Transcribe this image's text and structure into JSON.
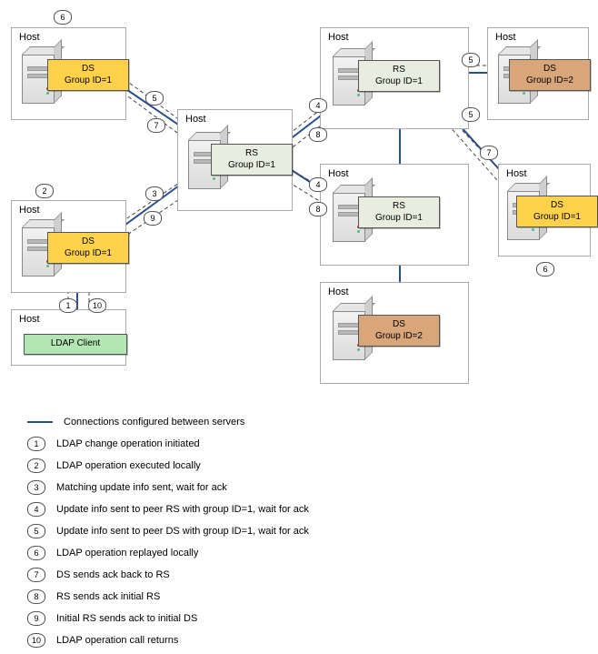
{
  "hosts": {
    "h1": {
      "label": "Host"
    },
    "h2": {
      "label": "Host"
    },
    "h3": {
      "label": "Host"
    },
    "h4": {
      "label": "Host"
    },
    "h5": {
      "label": "Host"
    },
    "h6": {
      "label": "Host"
    },
    "h7": {
      "label": "Host"
    },
    "h8": {
      "label": "Host"
    }
  },
  "nodes": {
    "ds_topleft": {
      "line1": "DS",
      "line2": "Group ID=1"
    },
    "ds_midleft": {
      "line1": "DS",
      "line2": "Group ID=1"
    },
    "rs_center": {
      "line1": "RS",
      "line2": "Group ID=1"
    },
    "rs_topright": {
      "line1": "RS",
      "line2": "Group ID=1"
    },
    "rs_mid2": {
      "line1": "RS",
      "line2": "Group ID=1"
    },
    "ds_bottom": {
      "line1": "DS",
      "line2": "Group ID=2"
    },
    "ds_right": {
      "line1": "DS",
      "line2": "Group ID=1"
    },
    "ds_topright": {
      "line1": "DS",
      "line2": "Group ID=2"
    },
    "client": {
      "label": "LDAP Client"
    }
  },
  "steps": [
    "1",
    "2",
    "3",
    "4",
    "5",
    "6",
    "7",
    "8",
    "9",
    "10"
  ],
  "legend": {
    "line": "Connections configured between servers",
    "items": [
      "LDAP change operation initiated",
      "LDAP operation executed locally",
      "Matching update info sent, wait for ack",
      "Update info sent to peer RS with group ID=1, wait for ack",
      "Update info sent to peer DS with group ID=1, wait for ack",
      "LDAP operation replayed locally",
      "DS sends ack back to RS",
      "RS sends ack initial RS",
      "Initial RS sends ack to initial DS",
      "LDAP operation call returns"
    ]
  },
  "chart_data": {
    "type": "table",
    "title": "Assured asynchronous replication sequence diagram",
    "nodes": [
      {
        "id": "client",
        "role": "LDAP Client"
      },
      {
        "id": "ds_midleft",
        "role": "DS",
        "group_id": 1
      },
      {
        "id": "ds_topleft",
        "role": "DS",
        "group_id": 1
      },
      {
        "id": "rs_center",
        "role": "RS",
        "group_id": 1
      },
      {
        "id": "rs_topright",
        "role": "RS",
        "group_id": 1
      },
      {
        "id": "rs_mid2",
        "role": "RS",
        "group_id": 1
      },
      {
        "id": "ds_right",
        "role": "DS",
        "group_id": 1
      },
      {
        "id": "ds_topright",
        "role": "DS",
        "group_id": 2
      },
      {
        "id": "ds_bottom",
        "role": "DS",
        "group_id": 2
      }
    ],
    "connections_solid": [
      [
        "client",
        "ds_midleft"
      ],
      [
        "ds_midleft",
        "rs_center"
      ],
      [
        "ds_topleft",
        "rs_center"
      ],
      [
        "rs_center",
        "rs_topright"
      ],
      [
        "rs_center",
        "rs_mid2"
      ],
      [
        "rs_topright",
        "ds_topright"
      ],
      [
        "rs_topright",
        "ds_right"
      ],
      [
        "rs_topright",
        "rs_mid2"
      ],
      [
        "rs_mid2",
        "ds_bottom"
      ]
    ],
    "sequence": [
      {
        "n": 1,
        "from": "client",
        "to": "ds_midleft",
        "text": "LDAP change operation initiated"
      },
      {
        "n": 2,
        "at": "ds_midleft",
        "text": "LDAP operation executed locally"
      },
      {
        "n": 3,
        "from": "ds_midleft",
        "to": "rs_center",
        "text": "Matching update info sent, wait for ack"
      },
      {
        "n": 4,
        "from": "rs_center",
        "to": [
          "rs_topright",
          "rs_mid2"
        ],
        "text": "Update info sent to peer RS with group ID=1, wait for ack"
      },
      {
        "n": 5,
        "from": "rs_center",
        "to": "ds_topleft",
        "text": "Update info sent to peer DS with group ID=1, wait for ack"
      },
      {
        "n": 5,
        "from": "rs_topright",
        "to": [
          "ds_right",
          "ds_topright"
        ],
        "text": "Update info sent to peer DS with group ID=1, wait for ack"
      },
      {
        "n": 6,
        "at": [
          "ds_topleft",
          "ds_right"
        ],
        "text": "LDAP operation replayed locally"
      },
      {
        "n": 7,
        "from": "ds_topleft",
        "to": "rs_center",
        "text": "DS sends ack back to RS"
      },
      {
        "n": 7,
        "from": "ds_right",
        "to": "rs_topright",
        "text": "DS sends ack back to RS"
      },
      {
        "n": 8,
        "from": [
          "rs_topright",
          "rs_mid2"
        ],
        "to": "rs_center",
        "text": "RS sends ack initial RS"
      },
      {
        "n": 9,
        "from": "rs_center",
        "to": "ds_midleft",
        "text": "Initial RS sends ack to initial DS"
      },
      {
        "n": 10,
        "from": "ds_midleft",
        "to": "client",
        "text": "LDAP operation call returns"
      }
    ]
  }
}
